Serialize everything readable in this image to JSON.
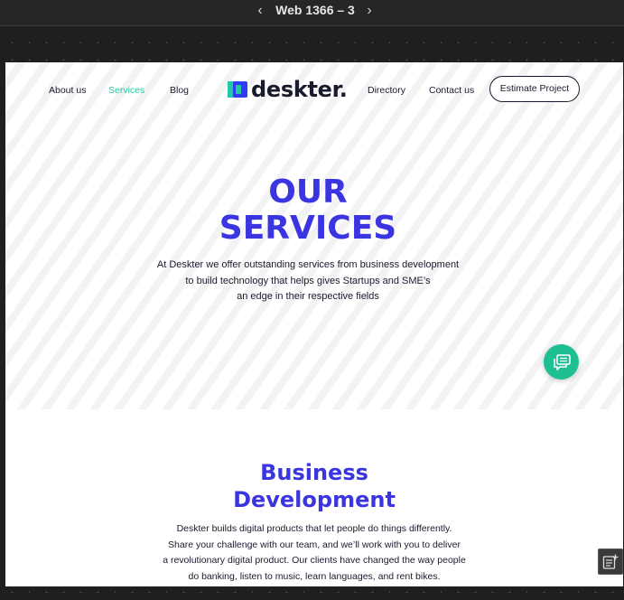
{
  "toolbar": {
    "artboard_title": "Web 1366 – 3",
    "prev_icon": "chevron-left-icon",
    "next_icon": "chevron-right-icon"
  },
  "site": {
    "nav": {
      "about": "About us",
      "services": "Services",
      "blog": "Blog",
      "directory": "Directory",
      "contact": "Contact us",
      "estimate": "Estimate Project"
    },
    "logo_text": "deskter.",
    "colors": {
      "primary": "#3a35e0",
      "accent": "#21c8a4",
      "fab": "#1fbf94",
      "text": "#1a1a2e"
    },
    "hero": {
      "title_line1": "OUR",
      "title_line2": "SERVICES",
      "desc_line1": "At Deskter we offer outstanding services from business development",
      "desc_line2": "to build technology that helps gives Startups and SME’s",
      "desc_line3": "an edge in their respective fields"
    },
    "section": {
      "title_line1": "Business",
      "title_line2": "Development",
      "desc_line1": "Deskter builds digital products that let people do things differently.",
      "desc_line2": "Share your challenge with our team, and we’ll work with you to deliver",
      "desc_line3": "a revolutionary digital product. Our clients have changed the way people",
      "desc_line4": "do banking, listen to music, learn languages, and rent bikes."
    },
    "chat_icon": "chat-bubble-icon"
  },
  "widget": {
    "icon": "comments-add-icon"
  }
}
